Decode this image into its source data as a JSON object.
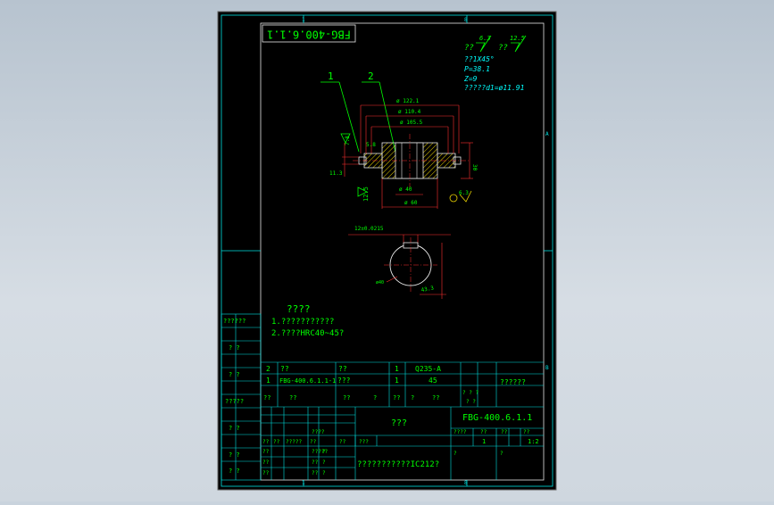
{
  "drawing": {
    "number_stamp": "FBG-400.6.1.1",
    "title_number": "FBG-400.6.1.1",
    "title_name": "???",
    "company": "???????????IC212?",
    "scale": "1:2",
    "sheet_count": "1",
    "material_spec": "45"
  },
  "border_marks": {
    "top_num": "8",
    "bottom_num": "8",
    "top_left_num": "1",
    "bottom_left_num": "1",
    "right_letter_a": "A",
    "right_letter_b": "B"
  },
  "roughness": {
    "label1": "??",
    "val1": "6.3",
    "label2": "??",
    "val2": "12.5",
    "note_chamfer": "??1X45°",
    "note_p": "P=38.1",
    "note_z": "Z=9",
    "note_d": "?????d1=ø11.91"
  },
  "callouts": {
    "part1": "1",
    "part2": "2"
  },
  "dimensions": {
    "d1": "ø 122.1",
    "d2": "ø 110.4",
    "d3": "ø 105.5",
    "d4": "ø 40",
    "d5": "ø 60",
    "d6": "ø 40",
    "d7": "30",
    "d8": "7.8",
    "d9": "5.8",
    "d10": "11.3",
    "d11": "12.5",
    "d12": "6.3",
    "kw": "12±0.0215",
    "kd": "43.3",
    "dia": "ø40"
  },
  "tech_req": {
    "title": "????",
    "line1": "1.???????????",
    "line2": "2.????HRC40~45?"
  },
  "left_table": {
    "r1": "??????",
    "r2": "? ?",
    "r3": "? ?",
    "r4": "?????",
    "r5": "? ?",
    "r6": "? ?",
    "r7": "? ?"
  },
  "bom": {
    "rows": [
      {
        "no": "2",
        "code": "??",
        "name": "??",
        "qty": "1",
        "mat": "Q235-A"
      },
      {
        "no": "1",
        "code": "FBG-400.6.1.1-1",
        "name": "???",
        "qty": "1",
        "mat": "45"
      }
    ],
    "header": [
      "??",
      "??",
      "??",
      "?",
      "??",
      "?",
      "??",
      "? ? ?",
      "? ?",
      "??????"
    ],
    "remark": "??????"
  },
  "title_block": {
    "mark": "????",
    "weight": "??",
    "ratio": "??",
    "stage": "??",
    "num1": "1",
    "q1": "???",
    "labels": [
      "??",
      "??",
      "?????",
      "????",
      "?????",
      "??",
      "??"
    ],
    "sign_a": "?",
    "sign_b": "?"
  }
}
